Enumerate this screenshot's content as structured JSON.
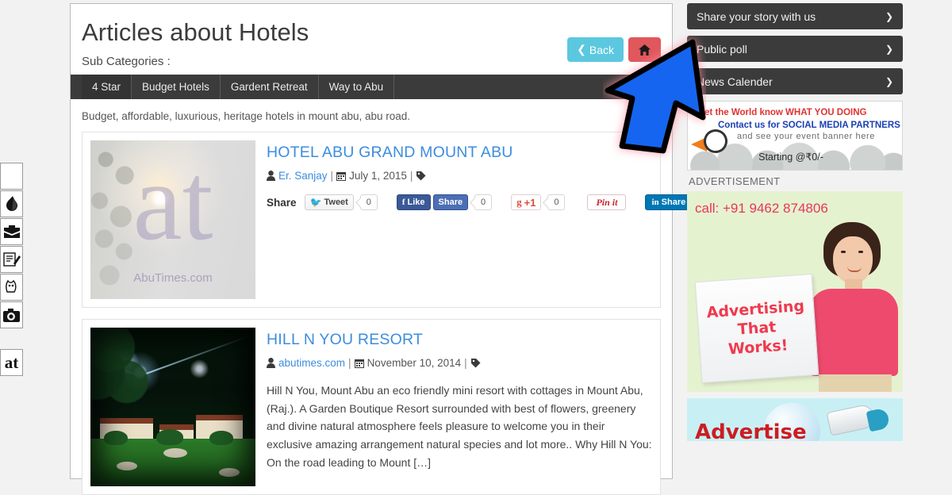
{
  "page": {
    "title": "Articles about Hotels",
    "subcategories_label": "Sub Categories :",
    "subcategory_description": "Budget, affordable, luxurious, heritage hotels in mount abu, abu road.",
    "accent_link_color": "#3c8dde",
    "tabbar_color": "#3b3b3b"
  },
  "header_buttons": {
    "back_label": "Back",
    "back_color": "#5bc8e0",
    "home_icon": "home-icon",
    "home_color": "#e0575c"
  },
  "tabs": [
    {
      "label": "4 Star",
      "active": true
    },
    {
      "label": "Budget Hotels",
      "active": false
    },
    {
      "label": "Gardent Retreat",
      "active": false
    },
    {
      "label": "Way to Abu",
      "active": false
    }
  ],
  "articles": [
    {
      "title": "HOTEL ABU GRAND MOUNT ABU",
      "author": "Er. Sanjay",
      "date": "July 1, 2015",
      "thumbnail_watermark_letters": "at",
      "thumbnail_watermark_site": "AbuTimes.com",
      "excerpt": "",
      "share": {
        "label": "Share",
        "tweet_label": "Tweet",
        "tweet_count": "0",
        "facebook_like_label": "Like",
        "facebook_share_label": "Share",
        "facebook_count": "0",
        "google_label": "+1",
        "google_count": "0",
        "pinterest_label": "Pin it",
        "linkedin_label": "Share"
      }
    },
    {
      "title": "HILL N YOU RESORT",
      "author": "abutimes.com",
      "date": "November 10, 2014",
      "excerpt": "Hill N You, Mount Abu an eco friendly mini resort with cottages in Mount Abu, (Raj.). A Garden Boutique Resort surrounded with best of flowers, greenery and divine natural atmosphere feels pleasure to welcome you in their exclusive amazing arrangement natural species and lot more.. Why Hill N You: On the road leading to Mount […]"
    }
  ],
  "sidebar": {
    "widgets": [
      {
        "label": "Share your story with us",
        "chevron": "chevron-down-icon"
      },
      {
        "label": "Public poll",
        "chevron": "chevron-down-icon"
      },
      {
        "label": "News Calender",
        "chevron": "chevron-down-icon"
      }
    ],
    "banner": {
      "line1": "Let the World know WHAT YOU DOING",
      "line2": "Contact us for SOCIAL MEDIA PARTNERS",
      "line3": "and see your event banner here",
      "line4": "Starting @₹0/-"
    },
    "advertisement_label": "ADVERTISEMENT",
    "ad_green": {
      "phone": "call: +91 9462 874806",
      "sign_line1": "Advertising",
      "sign_line2": "That",
      "sign_line3": "Works!",
      "background_color": "#e5f2d0"
    },
    "ad_cyan": {
      "word": "Advertise",
      "background_color": "#c8f0f4"
    }
  },
  "left_rail": {
    "items": [
      {
        "name": "blank-tool",
        "glyph": ""
      },
      {
        "name": "flame-icon",
        "glyph": "🔥"
      },
      {
        "name": "briefcase-icon",
        "glyph": "💼"
      },
      {
        "name": "notepad-pencil-icon",
        "glyph": "📝"
      },
      {
        "name": "animal-icon",
        "glyph": "🐕"
      },
      {
        "name": "camera-icon",
        "glyph": "📷"
      },
      {
        "name": "chat-label",
        "glyph": "at"
      }
    ]
  },
  "annotation": {
    "arrow_name": "blue-arrow-annotation",
    "arrow_fill": "#1565f0",
    "arrow_stroke": "#000000"
  }
}
